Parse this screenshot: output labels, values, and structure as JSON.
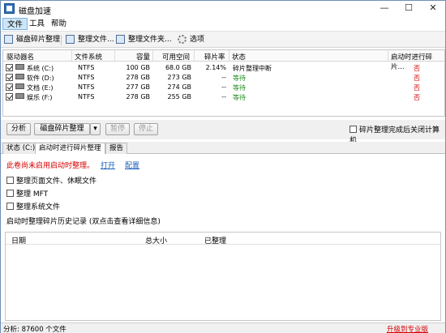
{
  "window": {
    "title": "磁盘加速",
    "minimize": "—",
    "maximize": "☐",
    "close": "✕"
  },
  "menu": [
    "文件",
    "工具",
    "帮助"
  ],
  "toolbar": {
    "defrag": "磁盘碎片整理",
    "defrag_file": "整理文件...",
    "defrag_folder": "整理文件夹...",
    "options": "选项"
  },
  "drive_list": {
    "headers": {
      "drive": "驱动器名",
      "fs": "文件系统",
      "capacity": "容量",
      "free": "可用空间",
      "frag": "碎片率",
      "status": "状态",
      "boot": "启动时进行碎片..."
    },
    "rows": [
      {
        "name": "系统 (C:)",
        "fs": "NTFS",
        "capacity": "100 GB",
        "free": "68.0 GB",
        "frag": "2.14%",
        "status": "碎片整理中断",
        "boot": "否"
      },
      {
        "name": "软件 (D:)",
        "fs": "NTFS",
        "capacity": "278 GB",
        "free": "273 GB",
        "frag": "--",
        "status": "等待",
        "boot": "否"
      },
      {
        "name": "文档 (E:)",
        "fs": "NTFS",
        "capacity": "277 GB",
        "free": "274 GB",
        "frag": "--",
        "status": "等待",
        "boot": "否"
      },
      {
        "name": "娱乐 (F:)",
        "fs": "NTFS",
        "capacity": "278 GB",
        "free": "255 GB",
        "frag": "--",
        "status": "等待",
        "boot": "否"
      }
    ]
  },
  "actions": {
    "analyze": "分析",
    "defrag": "磁盘碎片整理",
    "dropdown": "▾",
    "pause": "暂停",
    "stop": "停止",
    "shutdown_checkbox": "碎片整理完成后关闭计算机"
  },
  "tabs": [
    "状态 (C:)",
    "启动时进行碎片整理",
    "报告"
  ],
  "panel": {
    "warning": "此卷尚未启用启动时整理。",
    "open_link": "打开",
    "config_link": "配置",
    "options": [
      "整理页面文件、休眠文件",
      "整理 MFT",
      "整理系统文件"
    ],
    "history_title": "启动时整理碎片历史记录 (双点击查看详细信息)",
    "history_headers": {
      "date": "日期",
      "total": "总大小",
      "done": "已整理"
    }
  },
  "statusbar": {
    "left": "分析: 87600 个文件",
    "right": "升级到专业版"
  },
  "colors": {
    "accent": "#1b5eb7",
    "warning": "#d40000",
    "ok": "#1a8a1a"
  }
}
